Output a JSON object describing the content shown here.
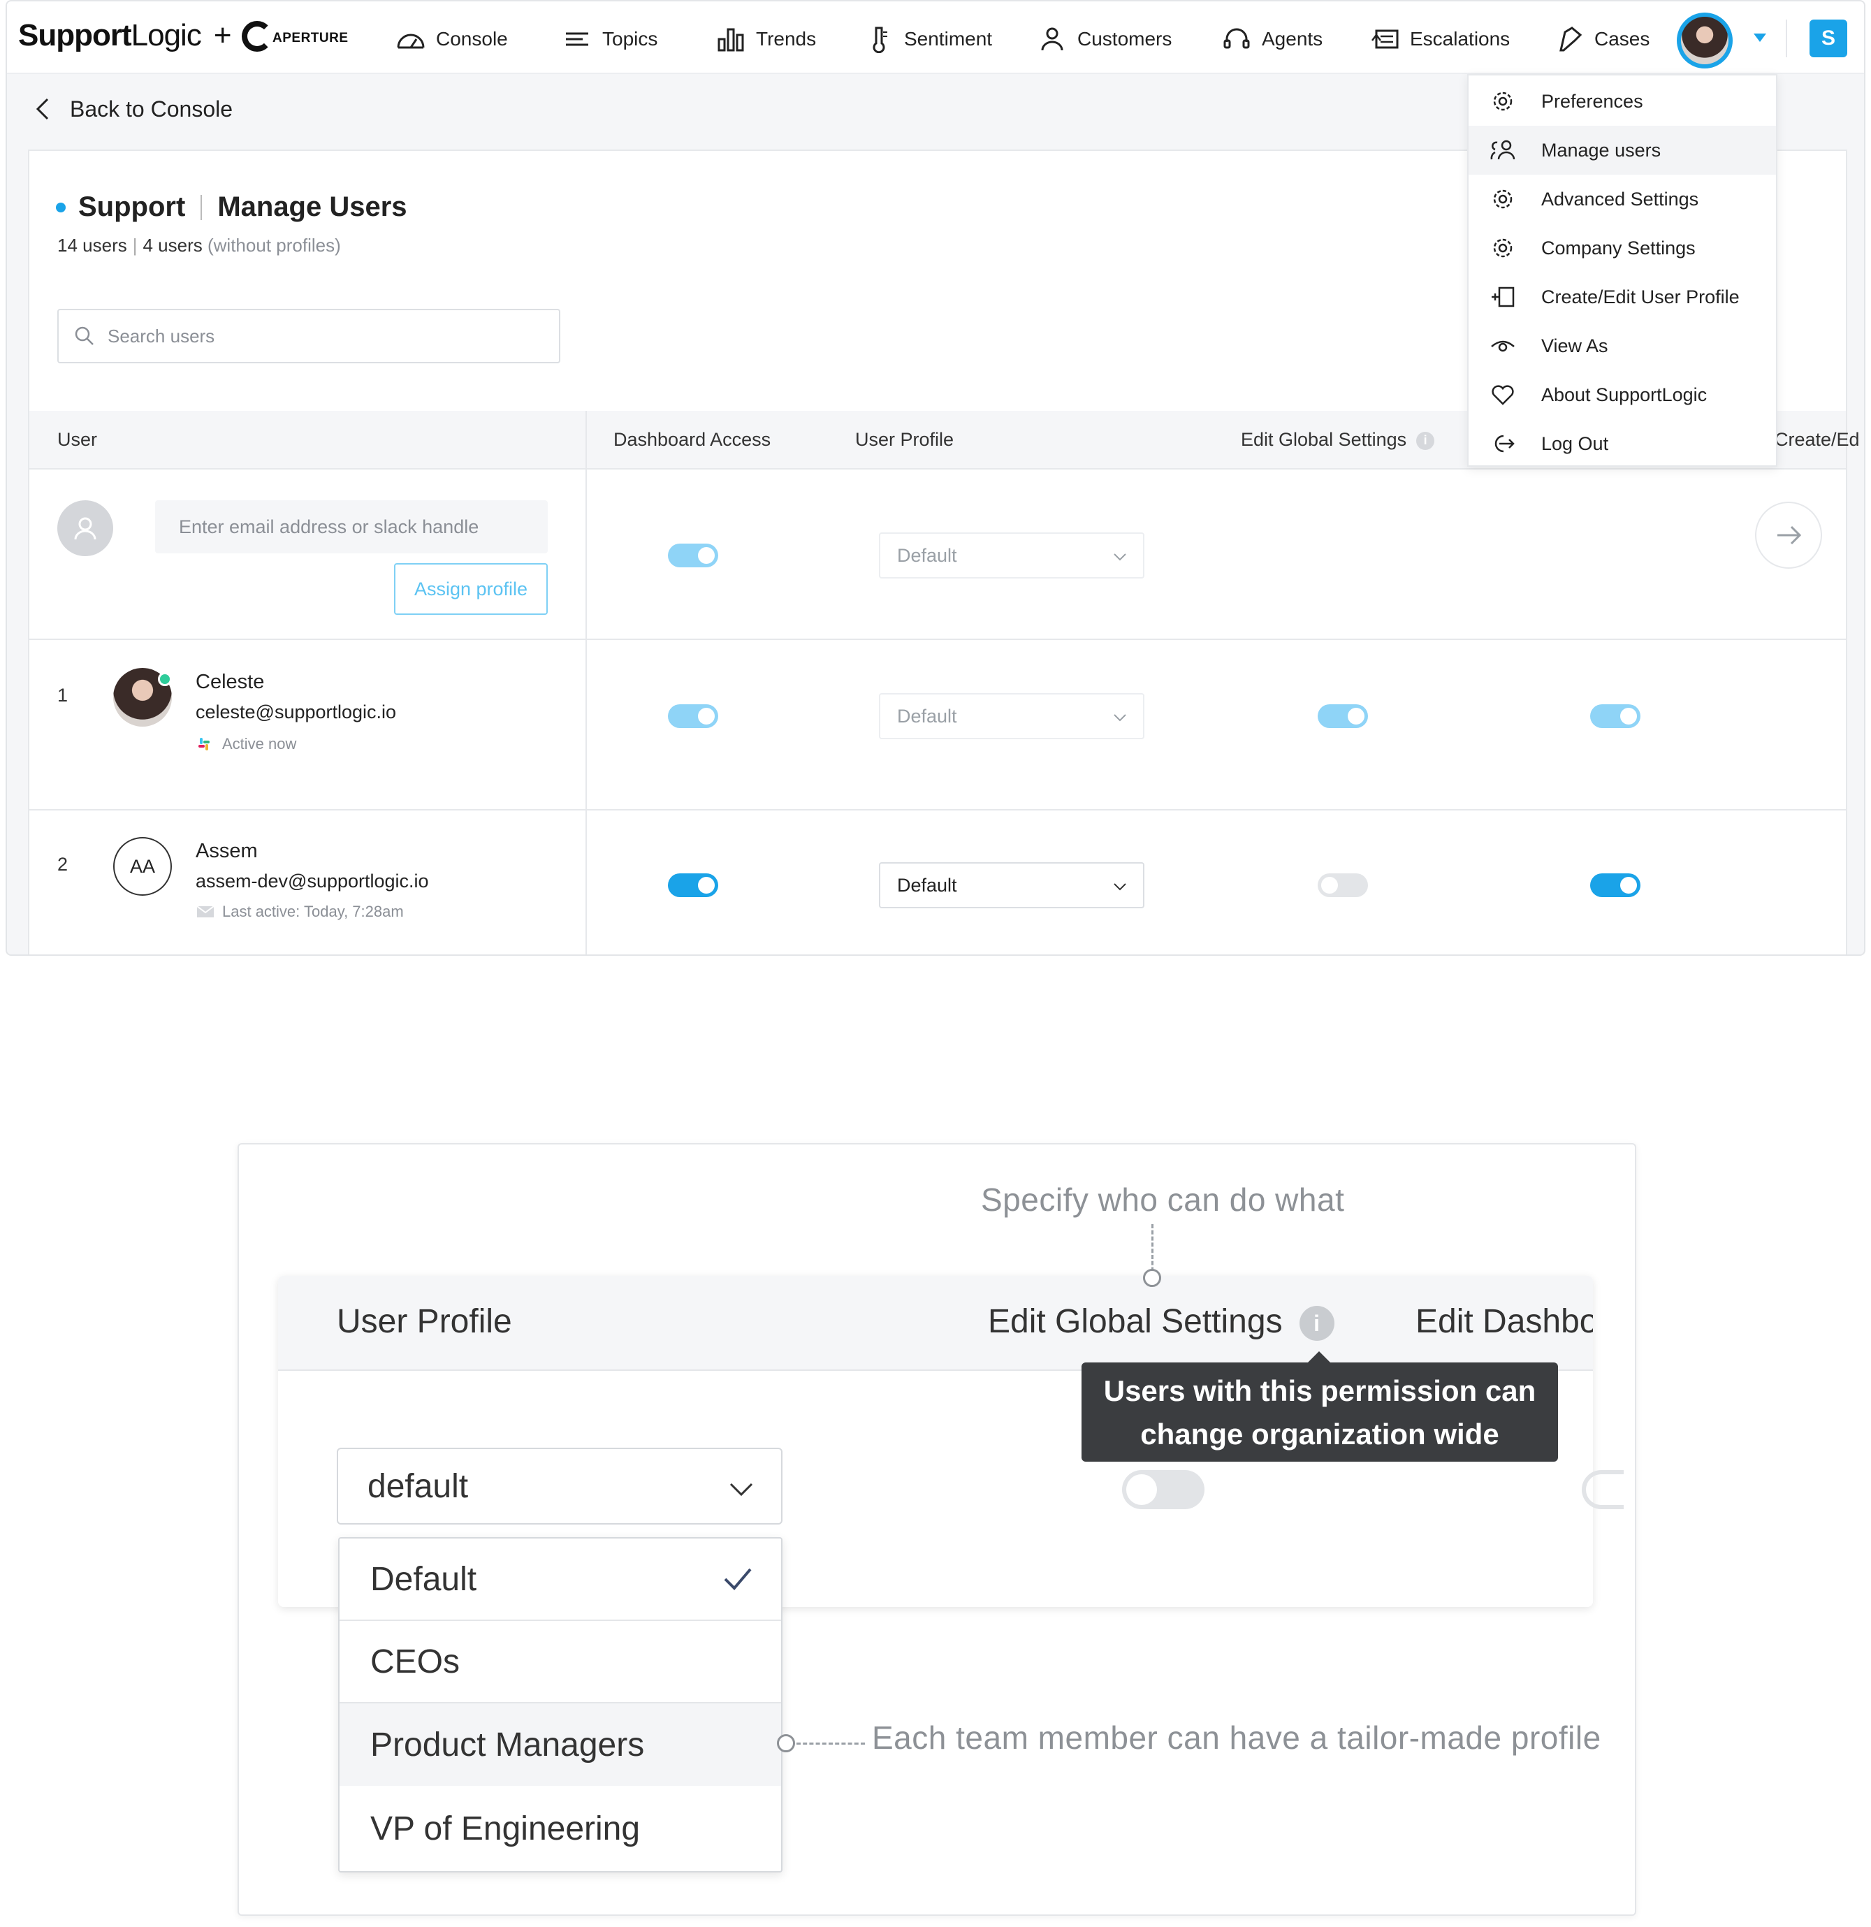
{
  "nav": {
    "brand_bold": "Support",
    "brand_light": "Logic",
    "plus": "+",
    "partner": "APERTURE",
    "items": [
      {
        "label": "Console",
        "icon": "gauge-icon"
      },
      {
        "label": "Topics",
        "icon": "topics-lines-icon"
      },
      {
        "label": "Trends",
        "icon": "bar-chart-icon"
      },
      {
        "label": "Sentiment",
        "icon": "thermometer-icon"
      },
      {
        "label": "Customers",
        "icon": "person-icon"
      },
      {
        "label": "Agents",
        "icon": "headset-icon"
      },
      {
        "label": "Escalations",
        "icon": "escalation-icon"
      },
      {
        "label": "Cases",
        "icon": "cases-icon"
      }
    ],
    "org_badge": "S",
    "accent": "#1aa3e8"
  },
  "back_label": "Back to Console",
  "page": {
    "title_team": "Support",
    "title_page": "Manage Users",
    "users_count": "14 users",
    "no_profile_count": "4 users",
    "no_profile_note": "(without profiles)",
    "search_placeholder": "Search users"
  },
  "table": {
    "headers": {
      "user": "User",
      "dashboard_access": "Dashboard Access",
      "user_profile": "User Profile",
      "edit_global": "Edit Global Settings",
      "create_edit": "Create/Ed"
    },
    "new_user": {
      "email_placeholder": "Enter email address or slack handle",
      "assign_label": "Assign profile",
      "profile": "Default"
    },
    "rows": [
      {
        "num": "1",
        "name": "Celeste",
        "email": "celeste@supportlogic.io",
        "status": "Active now",
        "profile": "Default"
      },
      {
        "num": "2",
        "initials": "AA",
        "name": "Assem",
        "email": "assem-dev@supportlogic.io",
        "status": "Last active: Today, 7:28am",
        "profile": "Default"
      }
    ]
  },
  "menu": {
    "items": [
      {
        "label": "Preferences",
        "icon": "gear-icon"
      },
      {
        "label": "Manage users",
        "icon": "users-icon"
      },
      {
        "label": "Advanced Settings",
        "icon": "gear-icon"
      },
      {
        "label": "Company Settings",
        "icon": "gear-icon"
      },
      {
        "label": "Create/Edit User Profile",
        "icon": "profile-add-icon"
      },
      {
        "label": "View As",
        "icon": "eye-icon"
      },
      {
        "label": "About SupportLogic",
        "icon": "heart-icon"
      },
      {
        "label": "Log Out",
        "icon": "logout-icon"
      }
    ],
    "selected": "Manage users"
  },
  "callout": {
    "annotation_top": "Specify who can do what",
    "annotation_right": "Each team member can have a tailor-made profile",
    "headers": {
      "user_profile": "User Profile",
      "edit_global": "Edit Global Settings",
      "edit_dash": "Edit Dashbo"
    },
    "tooltip_line1": "Users with this permission can",
    "tooltip_line2": "change organization wide settings",
    "selected_value": "default",
    "options": [
      "Default",
      "CEOs",
      "Product Managers",
      "VP of Engineering"
    ],
    "checked_option": "Default",
    "hovered_option": "Product Managers"
  }
}
